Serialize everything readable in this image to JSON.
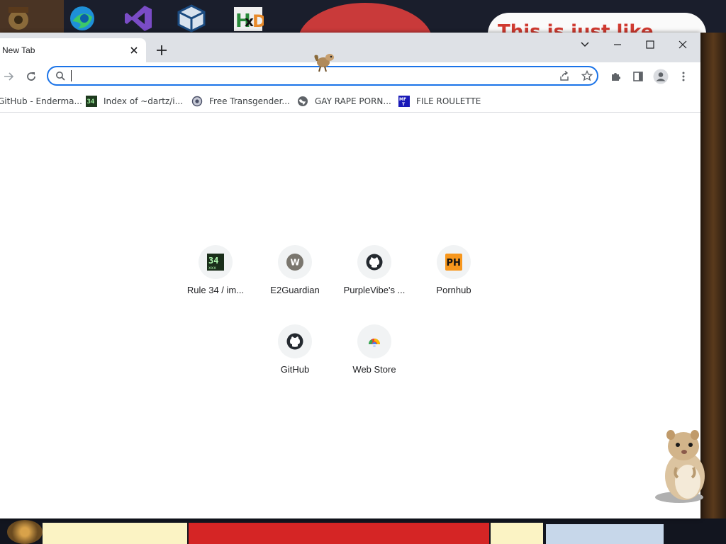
{
  "desktop": {
    "icons": [
      {
        "name": "steampunk-app-icon"
      },
      {
        "name": "edge-icon"
      },
      {
        "name": "visual-studio-icon"
      },
      {
        "name": "virtualbox-icon"
      },
      {
        "name": "hxd-icon",
        "label": "HxD"
      }
    ],
    "cloud_text": "This is just like"
  },
  "browser": {
    "tab": {
      "title": "New Tab"
    },
    "omnibox": {
      "value": "",
      "placeholder": ""
    },
    "bookmarks": [
      {
        "label": "GitHub - Enderma...",
        "icon": "github-icon"
      },
      {
        "label": "Index of ~dartz/i...",
        "icon": "rule34-icon"
      },
      {
        "label": "Free Transgender...",
        "icon": "bookmark-icon"
      },
      {
        "label": "GAY RAPE PORN...",
        "icon": "globe-icon"
      },
      {
        "label": "FILE ROULETTE",
        "icon": "file-roulette-icon"
      }
    ],
    "shortcuts": [
      {
        "label": "Rule 34 / im...",
        "icon": "rule34-icon",
        "icon_text": "34"
      },
      {
        "label": "E2Guardian",
        "icon": "e2guardian-icon",
        "icon_text": "W"
      },
      {
        "label": "PurpleVibe's ...",
        "icon": "github-icon"
      },
      {
        "label": "Pornhub",
        "icon": "pornhub-icon",
        "icon_text": "PH"
      },
      {
        "label": "GitHub",
        "icon": "github-icon"
      },
      {
        "label": "Web Store",
        "icon": "web-store-icon"
      }
    ]
  },
  "colors": {
    "accent": "#1a73e8",
    "tabstrip": "#dee1e6",
    "tile_bg": "#f1f3f4",
    "pornhub": "#f7971d"
  }
}
